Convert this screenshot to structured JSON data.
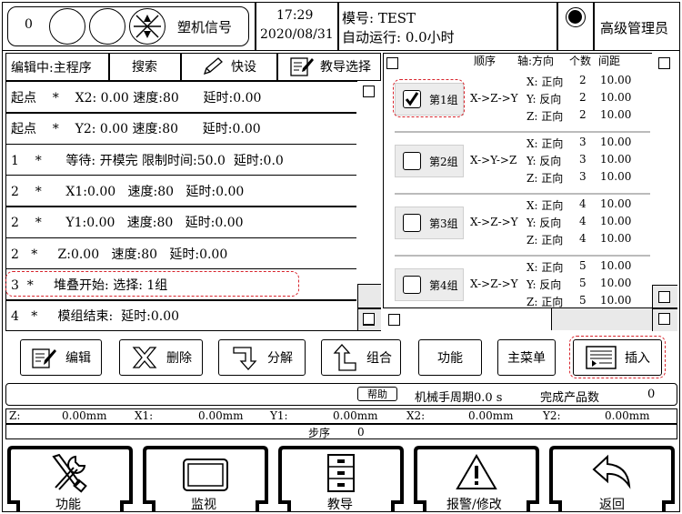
{
  "header": {
    "signal_value": "0",
    "signal_label": "塑机信号",
    "time": "17:29",
    "date": "2020/08/31",
    "mold_label": "模号: TEST",
    "auto_run_label": "自动运行: 0.0小时",
    "user_level": "高级管理员"
  },
  "toolbar": {
    "edit_main": "编辑中:主程序",
    "search": "搜索",
    "quick_set": "快设",
    "teach_select": "教导选择"
  },
  "program": [
    {
      "text": "起点    *    X2: 0.00 速度:80      延时:0.00"
    },
    {
      "text": "起点    *    Y2: 0.00 速度:80      延时:0.00"
    },
    {
      "text": "1    *      等待: 开模完 限制时间:50.0  延时:0.0"
    },
    {
      "text": "2    *      X1:0.00   速度:80   延时:0.00"
    },
    {
      "text": "2    *      Y1:0.00   速度:80   延时:0.00"
    },
    {
      "text": "2   *     Z:0.00   速度:80   延时:0.00"
    },
    {
      "text": "3  *     堆叠开始: 选择: 1组"
    },
    {
      "text": "4   *     模组结束:  延时:0.00"
    }
  ],
  "groups_header": {
    "order": "顺序",
    "axis_dir": "轴:方向",
    "count": "个数",
    "spacing": "间距"
  },
  "groups": [
    {
      "name": "第1组",
      "checked": true,
      "order": "X->Z->Y",
      "lines": [
        {
          "axis": "X: 正向",
          "count": "2",
          "spacing": "10.00"
        },
        {
          "axis": "Y: 反向",
          "count": "2",
          "spacing": "10.00"
        },
        {
          "axis": "Z: 正向",
          "count": "2",
          "spacing": "10.00"
        }
      ]
    },
    {
      "name": "第2组",
      "checked": false,
      "order": "X->Y->Z",
      "lines": [
        {
          "axis": "X: 正向",
          "count": "3",
          "spacing": "10.00"
        },
        {
          "axis": "Y: 反向",
          "count": "3",
          "spacing": "10.00"
        },
        {
          "axis": "Z: 正向",
          "count": "3",
          "spacing": "10.00"
        }
      ]
    },
    {
      "name": "第3组",
      "checked": false,
      "order": "X->Z->Y",
      "lines": [
        {
          "axis": "X: 正向",
          "count": "4",
          "spacing": "10.00"
        },
        {
          "axis": "Y: 反向",
          "count": "4",
          "spacing": "10.00"
        },
        {
          "axis": "Z: 正向",
          "count": "4",
          "spacing": "10.00"
        }
      ]
    },
    {
      "name": "第4组",
      "checked": false,
      "order": "X->Z->Y",
      "lines": [
        {
          "axis": "X: 正向",
          "count": "5",
          "spacing": "10.00"
        },
        {
          "axis": "Y: 反向",
          "count": "5",
          "spacing": "10.00"
        },
        {
          "axis": "Z: 正向",
          "count": "5",
          "spacing": "10.00"
        }
      ]
    }
  ],
  "actions": {
    "edit": "编辑",
    "delete": "删除",
    "split": "分解",
    "combine": "组合",
    "function": "功能",
    "main_menu": "主菜单",
    "insert": "插入"
  },
  "status": {
    "help": "帮助",
    "cycle": "机械手周期0.0 s",
    "finished_label": "完成产品数",
    "finished_value": "0",
    "positions": [
      {
        "axis": "Z:",
        "value": "0.00mm"
      },
      {
        "axis": "X1:",
        "value": "0.00mm"
      },
      {
        "axis": "Y1:",
        "value": "0.00mm"
      },
      {
        "axis": "X2:",
        "value": "0.00mm"
      },
      {
        "axis": "Y2:",
        "value": "0.00mm"
      }
    ],
    "step_label": "步序",
    "step_value": "0"
  },
  "nav": {
    "function": "功能",
    "monitor": "监视",
    "teach": "教导",
    "alarm": "报警/修改",
    "back": "返回"
  },
  "colors": {
    "highlight": "#d8242c"
  }
}
